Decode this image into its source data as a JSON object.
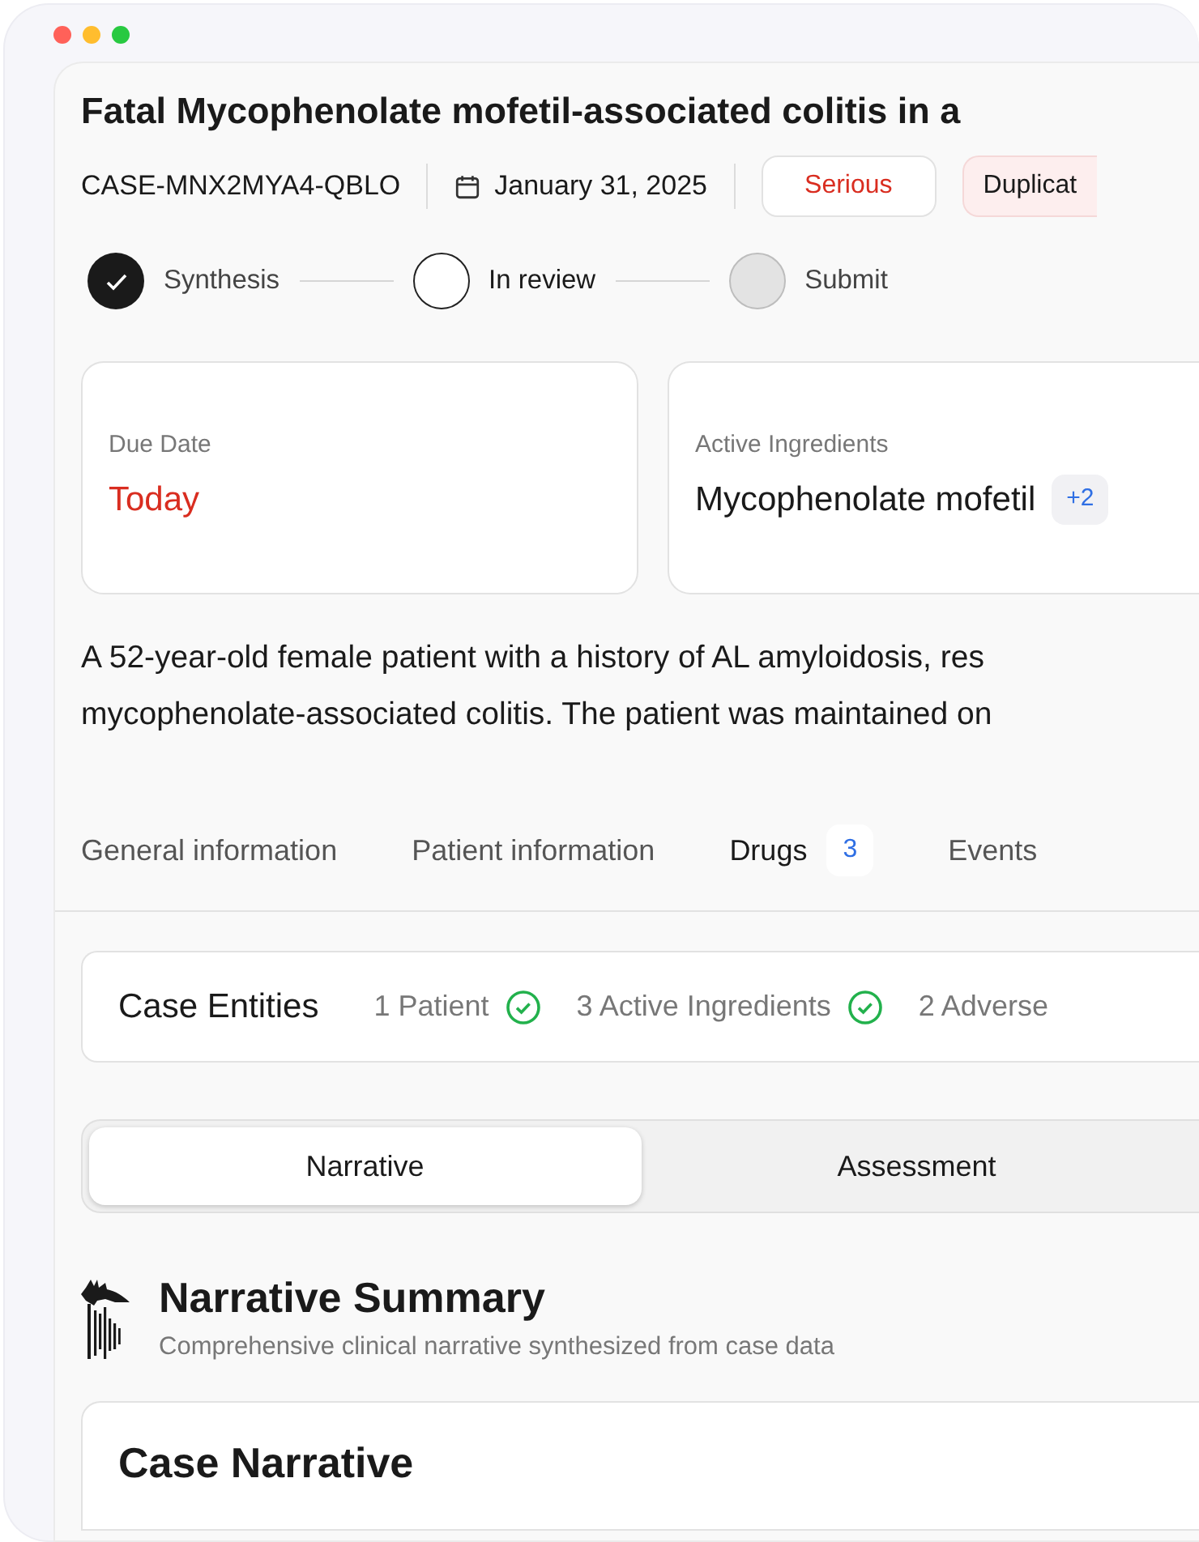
{
  "case": {
    "title": "Fatal Mycophenolate mofetil-associated colitis in a",
    "case_id": "CASE-MNX2MYA4-QBLO",
    "date": "January 31, 2025",
    "badges": [
      {
        "label": "Serious",
        "kind": "outline"
      },
      {
        "label": "Duplicat",
        "kind": "tinted"
      }
    ]
  },
  "steps": [
    {
      "label": "Synthesis",
      "kind": "done"
    },
    {
      "label": "In review",
      "kind": "current"
    },
    {
      "label": "Submit",
      "kind": "pending"
    }
  ],
  "cards": [
    {
      "label": "Due Date",
      "value": "Today",
      "kind": "alert"
    },
    {
      "label": "Active Ingredients",
      "value": "Mycophenolate mofetil",
      "extra": "+2",
      "kind": "plain"
    }
  ],
  "summary_lines": [
    "A 52-year-old female patient with a history of AL amyloidosis, res",
    "mycophenolate-associated colitis. The patient was maintained on"
  ],
  "tabs": [
    {
      "label": "General information",
      "selected": false
    },
    {
      "label": "Patient information",
      "selected": false
    },
    {
      "label": "Drugs",
      "count": "3",
      "selected": true
    },
    {
      "label": "Events",
      "selected": false
    }
  ],
  "entities": {
    "title": "Case Entities",
    "items": [
      {
        "label": "1 Patient",
        "checked": true
      },
      {
        "label": "3 Active Ingredients",
        "checked": true
      },
      {
        "label": "2 Adverse",
        "checked": false
      }
    ]
  },
  "views": [
    {
      "label": "Narrative",
      "selected": true
    },
    {
      "label": "Assessment",
      "selected": false
    }
  ],
  "narrative": {
    "title": "Narrative Summary",
    "subtitle": "Comprehensive clinical narrative synthesized from case data",
    "card_title": "Case Narrative"
  }
}
